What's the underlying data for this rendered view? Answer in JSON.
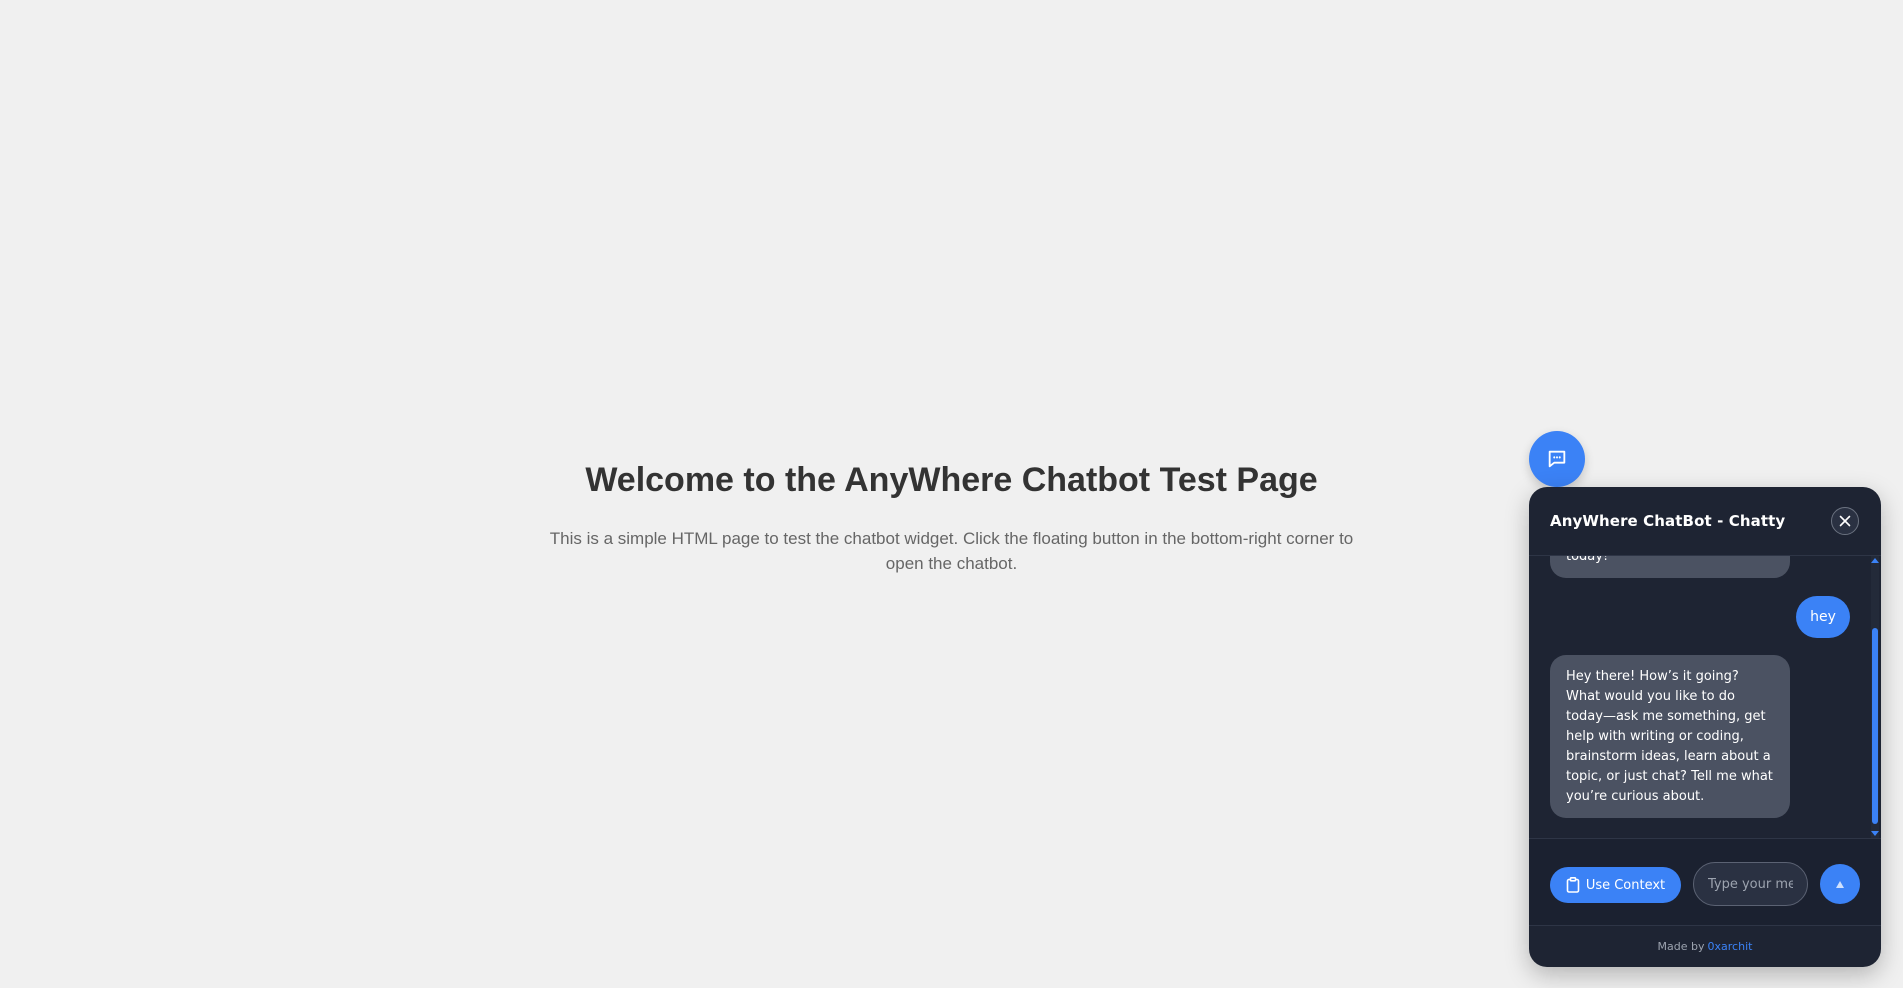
{
  "page": {
    "title": "Welcome to the AnyWhere Chatbot Test Page",
    "description": "This is a simple HTML page to test the chatbot widget. Click the floating button in the bottom-right corner to open the chatbot."
  },
  "launcher": {
    "icon": "chat-bubble-icon"
  },
  "chat": {
    "title": "AnyWhere ChatBot - Chatty",
    "close_icon": "close-icon",
    "messages": [
      {
        "role": "bot",
        "text": "today!"
      },
      {
        "role": "user",
        "text": "hey"
      },
      {
        "role": "bot",
        "text": "Hey there! How’s it going? What would you like to do today—ask me something, get help with writing or coding, brainstorm ideas, learn about a topic, or just chat? Tell me what you’re curious about."
      }
    ],
    "use_context_label": "Use Context",
    "use_context_icon": "clipboard-icon",
    "input_placeholder": "Type your message...",
    "send_icon": "send-arrow-icon",
    "footer_prefix": "Made by",
    "footer_link": "0xarchit"
  },
  "colors": {
    "accent": "#3b82f6",
    "page_background": "#f0f0f0",
    "chat_background": "#1e2433",
    "bot_bubble": "#4b5262"
  }
}
